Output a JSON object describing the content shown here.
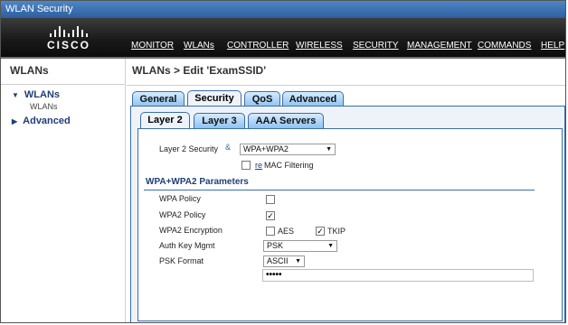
{
  "window": {
    "title": "WLAN Security"
  },
  "brand": {
    "logo_text": "CISCO"
  },
  "nav": {
    "items": [
      "MONITOR",
      "WLANs",
      "CONTROLLER",
      "WIRELESS",
      "SECURITY",
      "MANAGEMENT",
      "COMMANDS",
      "HELP"
    ]
  },
  "sidebar": {
    "title": "WLANs",
    "items": [
      {
        "label": "WLANs",
        "expanded": true,
        "sub": "WLANs"
      },
      {
        "label": "Advanced",
        "expanded": false
      }
    ]
  },
  "page": {
    "breadcrumb": "WLANs > Edit  'ExamSSID'"
  },
  "tabs": [
    "General",
    "Security",
    "QoS",
    "Advanced"
  ],
  "subtabs": [
    "Layer 2",
    "Layer 3",
    "AAA Servers"
  ],
  "layer2": {
    "security_label": "Layer 2 Security",
    "security_marker": "&",
    "security_value": "WPA+WPA2",
    "mac_filter_label": "MAC Filtering",
    "mac_filter_marker": "re"
  },
  "wpa": {
    "section_title": "WPA+WPA2 Parameters",
    "policy_label": "WPA Policy",
    "policy_checked": false,
    "wpa2_policy_label": "WPA2 Policy",
    "wpa2_policy_checked": true,
    "encryption_label": "WPA2 Encryption",
    "aes_label": "AES",
    "aes_checked": false,
    "tkip_label": "TKIP",
    "tkip_checked": true,
    "authkey_label": "Auth Key Mgmt",
    "authkey_value": "PSK",
    "psk_format_label": "PSK Format",
    "psk_format_value": "ASCII",
    "psk_value": "•••••"
  },
  "colors": {
    "accent": "#3b6ea8",
    "tab_blue": "#8fc2f0",
    "nav_bg": "#1a1a1a"
  }
}
